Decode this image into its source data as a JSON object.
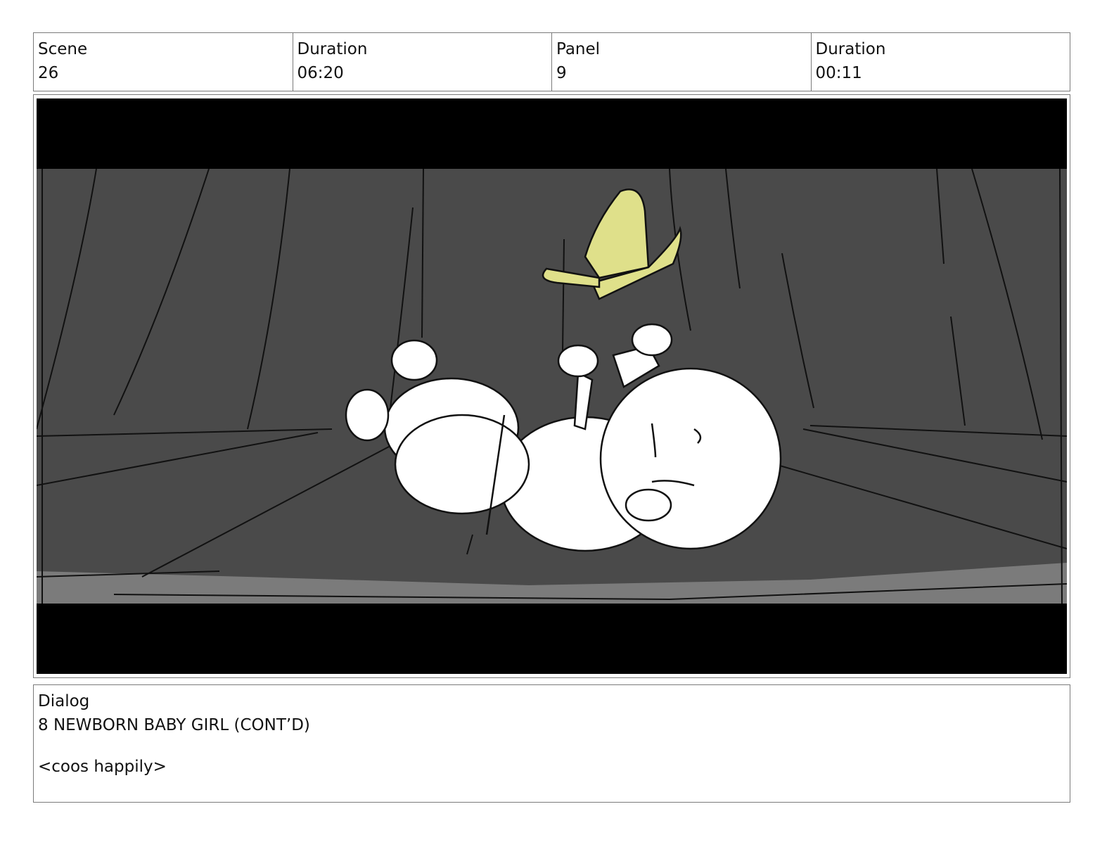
{
  "header": {
    "scene_label": "Scene",
    "scene_value": "26",
    "duration_label": "Duration",
    "duration_value": "06:20",
    "panel_label": "Panel",
    "panel_value": "9",
    "panel_duration_label": "Duration",
    "panel_duration_value": "00:11"
  },
  "dialog": {
    "label": "Dialog",
    "character": "8 NEWBORN BABY GIRL (CONT’D)",
    "line": "<coos happily>"
  },
  "colors": {
    "letterbox": "#000000",
    "background": "#4a4a4a",
    "floor_edge": "#7b7b7b",
    "butterfly": "#dfe08a",
    "baby": "#ffffff"
  }
}
